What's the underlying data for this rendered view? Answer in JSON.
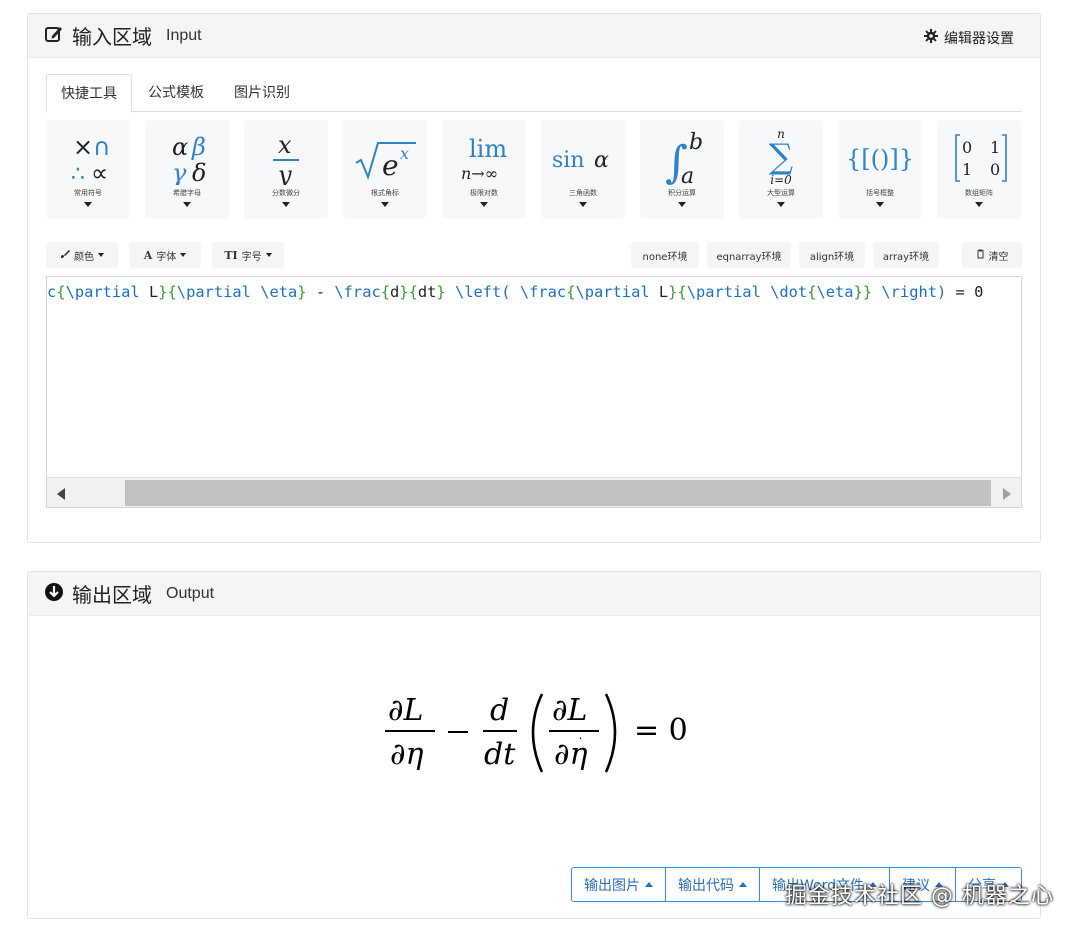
{
  "input_panel": {
    "title_zh": "输入区域",
    "title_en": "Input",
    "settings_label": "编辑器设置"
  },
  "tabs": [
    {
      "label": "快捷工具",
      "active": true
    },
    {
      "label": "公式模板",
      "active": false
    },
    {
      "label": "图片识别",
      "active": false
    }
  ],
  "tools": [
    {
      "label": "常用符号"
    },
    {
      "label": "希腊字母"
    },
    {
      "label": "分数微分"
    },
    {
      "label": "根式角标"
    },
    {
      "label": "极限对数"
    },
    {
      "label": "三角函数"
    },
    {
      "label": "积分运算"
    },
    {
      "label": "大型运算"
    },
    {
      "label": "括号框整"
    },
    {
      "label": "数组矩阵"
    }
  ],
  "format_buttons": {
    "color": "颜色",
    "font": "字体",
    "size": "字号"
  },
  "env_buttons": {
    "none": "none环境",
    "eqnarray": "eqnarray环境",
    "align": "align环境",
    "array": "array环境",
    "clear": "清空"
  },
  "editor": {
    "code": "c{\\partial L}{\\partial \\eta} - \\frac{d}{dt} \\left( \\frac{\\partial L}{\\partial \\dot{\\eta}} \\right) = 0"
  },
  "output_panel": {
    "title_zh": "输出区域",
    "title_en": "Output"
  },
  "output_buttons": {
    "image": "输出图片",
    "code": "输出代码",
    "word": "输出Word文件",
    "suggest": "建议",
    "share": "分享"
  },
  "watermark": "掘金技术社区 @ 机器之心",
  "colors": {
    "accent": "#2f82c6",
    "button_border": "#3c8ad6"
  }
}
